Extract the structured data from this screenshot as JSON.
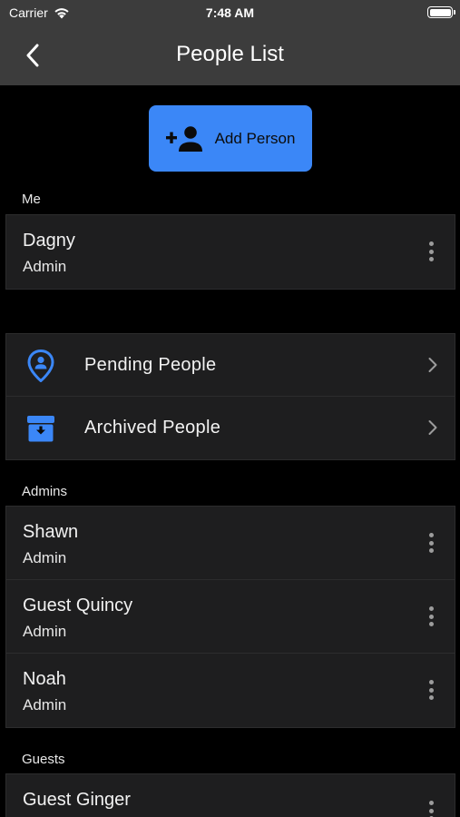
{
  "status_bar": {
    "carrier": "Carrier",
    "time": "7:48 AM"
  },
  "nav": {
    "title": "People List",
    "back_icon": "chevron-left-icon"
  },
  "add_button": {
    "label": "Add Person",
    "icon": "add-person-icon",
    "color": "#3b87f7"
  },
  "me": {
    "label": "Me",
    "person": {
      "name": "Dagny",
      "role": "Admin"
    }
  },
  "links": [
    {
      "label": "Pending People",
      "icon": "location-person-icon"
    },
    {
      "label": "Archived People",
      "icon": "archive-box-icon"
    }
  ],
  "admins": {
    "label": "Admins",
    "people": [
      {
        "name": "Shawn",
        "role": "Admin"
      },
      {
        "name": "Guest Quincy",
        "role": "Admin"
      },
      {
        "name": "Noah",
        "role": "Admin"
      }
    ]
  },
  "guests": {
    "label": "Guests",
    "people": [
      {
        "name": "Guest Ginger",
        "role": ""
      }
    ]
  },
  "colors": {
    "accent": "#3b87f7",
    "background": "#000000",
    "bar": "#3c3c3c",
    "card": "#1e1e1f"
  }
}
